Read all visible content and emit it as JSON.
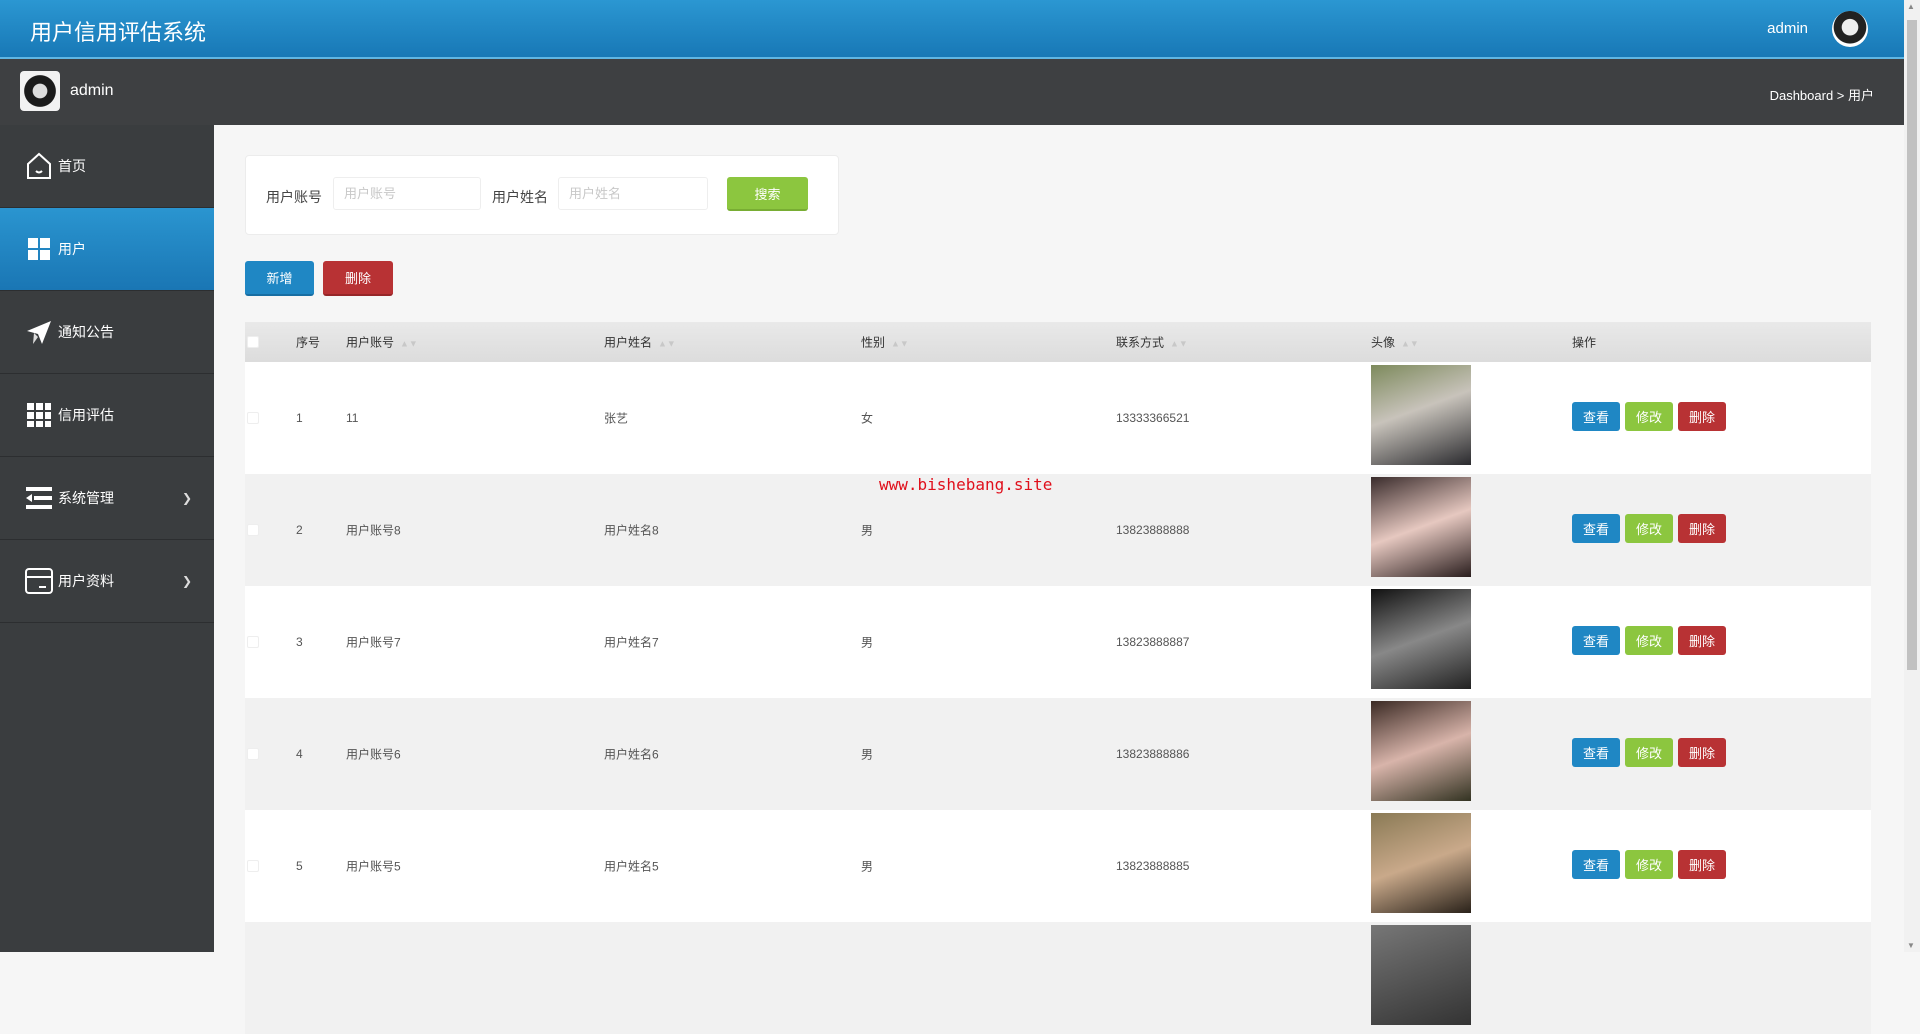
{
  "header": {
    "title": "用户信用评估系统",
    "user": "admin"
  },
  "subbar": {
    "user": "admin",
    "breadcrumb": "Dashboard > 用户"
  },
  "sidebar": {
    "items": [
      {
        "label": "首页",
        "icon": "home-icon"
      },
      {
        "label": "用户",
        "icon": "grid-icon",
        "active": true
      },
      {
        "label": "通知公告",
        "icon": "paper-plane-icon"
      },
      {
        "label": "信用评估",
        "icon": "apps-icon"
      },
      {
        "label": "系统管理",
        "icon": "menu-icon",
        "expandable": true
      },
      {
        "label": "用户资料",
        "icon": "card-icon",
        "expandable": true
      }
    ]
  },
  "search": {
    "account_label": "用户账号",
    "account_placeholder": "用户账号",
    "account_value": "",
    "name_label": "用户姓名",
    "name_placeholder": "用户姓名",
    "name_value": "",
    "button": "搜索"
  },
  "actions": {
    "add": "新增",
    "delete": "删除"
  },
  "table": {
    "headers": [
      "序号",
      "用户账号",
      "用户姓名",
      "性别",
      "联系方式",
      "头像",
      "操作"
    ],
    "row_buttons": {
      "view": "查看",
      "edit": "修改",
      "delete": "删除"
    },
    "rows": [
      {
        "no": "1",
        "account": "11",
        "name": "张艺",
        "gender": "女",
        "phone": "13333366521"
      },
      {
        "no": "2",
        "account": "用户账号8",
        "name": "用户姓名8",
        "gender": "男",
        "phone": "13823888888"
      },
      {
        "no": "3",
        "account": "用户账号7",
        "name": "用户姓名7",
        "gender": "男",
        "phone": "13823888887"
      },
      {
        "no": "4",
        "account": "用户账号6",
        "name": "用户姓名6",
        "gender": "男",
        "phone": "13823888886"
      },
      {
        "no": "5",
        "account": "用户账号5",
        "name": "用户姓名5",
        "gender": "男",
        "phone": "13823888885"
      }
    ]
  },
  "watermark": "www.bishebang.site",
  "colors": {
    "primary": "#1f87c4",
    "success": "#8cc63f",
    "danger": "#b83234",
    "sidebar": "#3a3d3f"
  }
}
